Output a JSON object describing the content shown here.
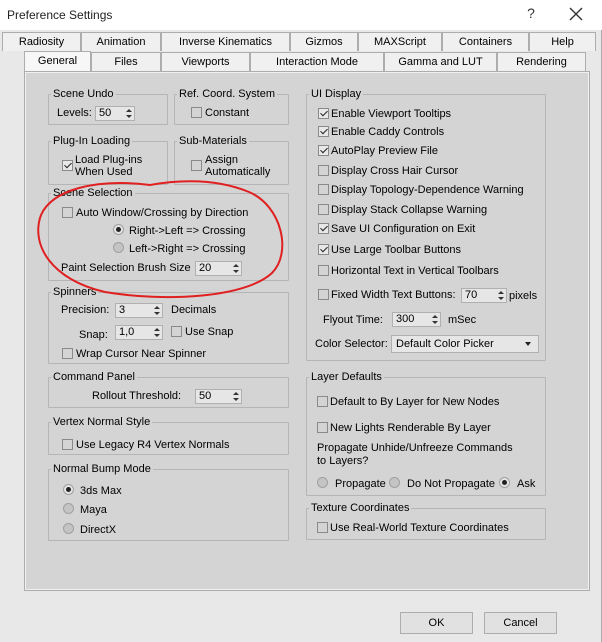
{
  "window": {
    "title": "Preference Settings",
    "help_label": "?",
    "close_label": "✕"
  },
  "tabs_row1": [
    "Radiosity",
    "Animation",
    "Inverse Kinematics",
    "Gizmos",
    "MAXScript",
    "Containers",
    "Help"
  ],
  "tabs_row2": [
    "General",
    "Files",
    "Viewports",
    "Interaction Mode",
    "Gamma and LUT",
    "Rendering"
  ],
  "active_tab": "General",
  "scene_undo": {
    "title": "Scene Undo",
    "levels_label": "Levels:",
    "levels_value": "50"
  },
  "ref_coord": {
    "title": "Ref. Coord. System",
    "constant_label": "Constant",
    "constant_checked": false
  },
  "plugin": {
    "title": "Plug-In Loading",
    "load_label_1": "Load Plug-ins",
    "load_label_2": "When Used",
    "load_checked": true
  },
  "submat": {
    "title": "Sub-Materials",
    "assign_label_1": "Assign",
    "assign_label_2": "Automatically",
    "assign_checked": false
  },
  "scene_selection": {
    "title": "Scene Selection",
    "auto_window_label": "Auto Window/Crossing by Direction",
    "auto_window_checked": false,
    "radio_rl_label": "Right->Left => Crossing",
    "radio_lr_label": "Left->Right => Crossing",
    "brush_label": "Paint Selection Brush Size",
    "brush_value": "20"
  },
  "spinners": {
    "title": "Spinners",
    "precision_label": "Precision:",
    "precision_value": "3",
    "decimals_label": "Decimals",
    "snap_label": "Snap:",
    "snap_value": "1,0",
    "use_snap_label": "Use Snap",
    "wrap_label": "Wrap Cursor Near Spinner"
  },
  "command_panel": {
    "title": "Command Panel",
    "rollout_label": "Rollout Threshold:",
    "rollout_value": "50"
  },
  "vertex_normal": {
    "title": "Vertex Normal Style",
    "legacy_label": "Use Legacy R4 Vertex Normals"
  },
  "normal_bump": {
    "title": "Normal Bump Mode",
    "options": [
      "3ds Max",
      "Maya",
      "DirectX"
    ],
    "selected": "3ds Max"
  },
  "ui_display": {
    "title": "UI Display",
    "options": [
      {
        "label": "Enable Viewport Tooltips",
        "checked": true
      },
      {
        "label": "Enable Caddy Controls",
        "checked": true
      },
      {
        "label": "AutoPlay Preview File",
        "checked": true
      },
      {
        "label": "Display Cross Hair Cursor",
        "checked": false
      },
      {
        "label": "Display Topology-Dependence Warning",
        "checked": false
      },
      {
        "label": "Display Stack Collapse Warning",
        "checked": false
      },
      {
        "label": "Save UI Configuration on Exit",
        "checked": true
      },
      {
        "label": "Use Large Toolbar Buttons",
        "checked": true
      },
      {
        "label": "Horizontal Text in Vertical Toolbars",
        "checked": false
      }
    ],
    "fixed_width_label": "Fixed Width Text Buttons:",
    "fixed_width_value": "70",
    "pixels_label": "pixels",
    "flyout_label": "Flyout Time:",
    "flyout_value": "300",
    "msec_label": "mSec",
    "color_selector_label": "Color Selector:",
    "color_selector_value": "Default Color Picker"
  },
  "layer_defaults": {
    "title": "Layer Defaults",
    "default_bylayer_label": "Default to By Layer for New Nodes",
    "new_lights_label": "New Lights Renderable By Layer",
    "propagate_question_1": "Propagate Unhide/Unfreeze Commands",
    "propagate_question_2": "to Layers?",
    "propagate_options": [
      "Propagate",
      "Do Not Propagate",
      "Ask"
    ],
    "propagate_selected": "Ask"
  },
  "texture_coords": {
    "title": "Texture Coordinates",
    "realworld_label": "Use Real-World Texture Coordinates"
  },
  "buttons": {
    "ok": "OK",
    "cancel": "Cancel"
  },
  "colors": {
    "annotation": "#e02020",
    "panel": "#d4d4d4"
  }
}
